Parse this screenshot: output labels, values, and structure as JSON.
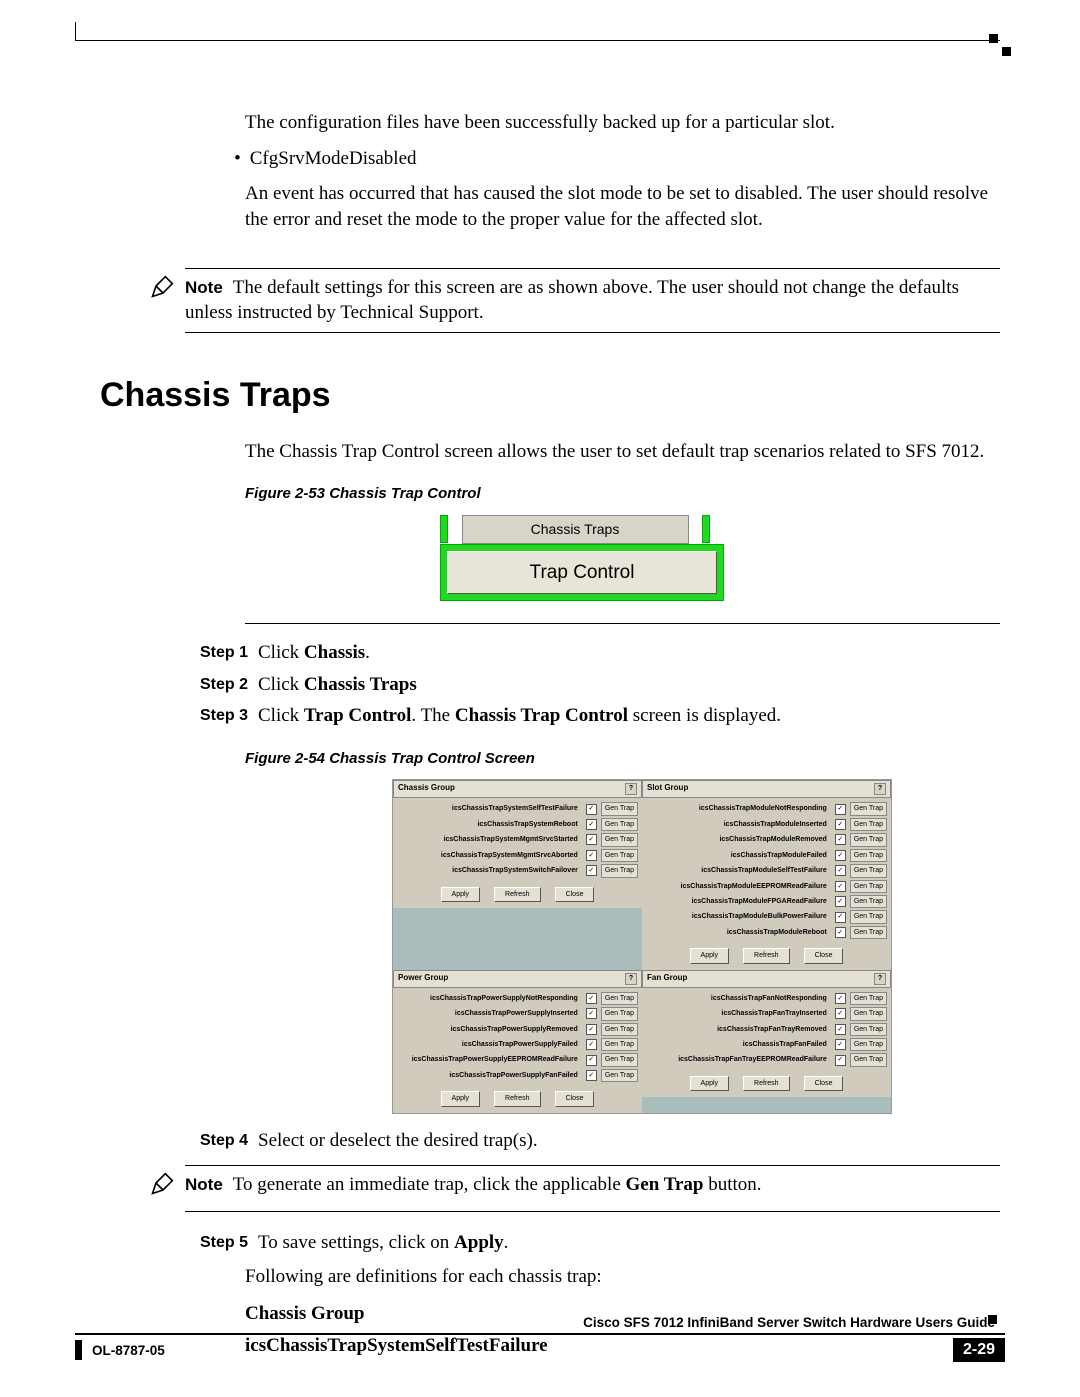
{
  "intro": {
    "backup_text": "The configuration files have been successfully backed up for a particular slot.",
    "bullet_label": "CfgSrvModeDisabled",
    "disabled_text": "An event has occurred that has caused the slot mode to be set to disabled. The user should resolve the error and reset the mode to the proper value for the affected slot."
  },
  "note1": {
    "label": "Note",
    "text": "The default settings for this screen are as shown above. The user should not change the defaults unless instructed by Technical Support."
  },
  "section_heading": "Chassis Traps",
  "section_intro": "The Chassis Trap Control screen allows the user to set default trap scenarios related to SFS 7012.",
  "fig53": {
    "caption": "Figure 2-53   Chassis Trap Control",
    "tab_label": "Chassis Traps",
    "button_label": "Trap Control"
  },
  "steps": [
    {
      "label": "Step 1",
      "prefix": "Click ",
      "bold": "Chassis",
      "suffix": "."
    },
    {
      "label": "Step 2",
      "prefix": "Click ",
      "bold": "Chassis Traps",
      "suffix": ""
    },
    {
      "label": "Step 3",
      "prefix": "Click ",
      "bold": "Trap Control",
      "mid": ". The ",
      "bold2": "Chassis Trap Control",
      "suffix": " screen is displayed."
    },
    {
      "label": "Step 4",
      "prefix": "Select or deselect the desired trap(s).",
      "bold": "",
      "suffix": ""
    },
    {
      "label": "Step 5",
      "prefix": "To save settings, click on ",
      "bold": "Apply",
      "suffix": "."
    }
  ],
  "fig54": {
    "caption": "Figure 2-54   Chassis Trap Control Screen",
    "gen_trap_label": "Gen Trap",
    "apply": "Apply",
    "refresh": "Refresh",
    "close": "Close",
    "question": "?",
    "groups": {
      "chassis": {
        "title": "Chassis Group",
        "items": [
          "icsChassisTrapSystemSelfTestFailure",
          "icsChassisTrapSystemReboot",
          "icsChassisTrapSystemMgmtSrvcStarted",
          "icsChassisTrapSystemMgmtSrvcAborted",
          "icsChassisTrapSystemSwitchFailover"
        ]
      },
      "slot": {
        "title": "Slot Group",
        "items": [
          "icsChassisTrapModuleNotResponding",
          "icsChassisTrapModuleInserted",
          "icsChassisTrapModuleRemoved",
          "icsChassisTrapModuleFailed",
          "icsChassisTrapModuleSelfTestFailure",
          "icsChassisTrapModuleEEPROMReadFailure",
          "icsChassisTrapModuleFPGAReadFailure",
          "icsChassisTrapModuleBulkPowerFailure",
          "icsChassisTrapModuleReboot"
        ]
      },
      "power": {
        "title": "Power Group",
        "items": [
          "icsChassisTrapPowerSupplyNotResponding",
          "icsChassisTrapPowerSupplyInserted",
          "icsChassisTrapPowerSupplyRemoved",
          "icsChassisTrapPowerSupplyFailed",
          "icsChassisTrapPowerSupplyEEPROMReadFailure",
          "icsChassisTrapPowerSupplyFanFailed"
        ]
      },
      "fan": {
        "title": "Fan Group",
        "items": [
          "icsChassisTrapFanNotResponding",
          "icsChassisTrapFanTrayInserted",
          "icsChassisTrapFanTrayRemoved",
          "icsChassisTrapFanFailed",
          "icsChassisTrapFanTrayEEPROMReadFailure"
        ]
      }
    }
  },
  "note2": {
    "label": "Note",
    "text_pre": "To generate an immediate trap, click the applicable ",
    "bold": "Gen Trap",
    "text_post": " button."
  },
  "following_text": "Following are definitions for each chassis trap:",
  "group_heading": "Chassis Group",
  "trap_def_heading": "icsChassisTrapSystemSelfTestFailure",
  "footer": {
    "title": "Cisco SFS 7012 InfiniBand Server Switch Hardware Users Guide",
    "doc": "OL-8787-05",
    "page": "2-29"
  }
}
